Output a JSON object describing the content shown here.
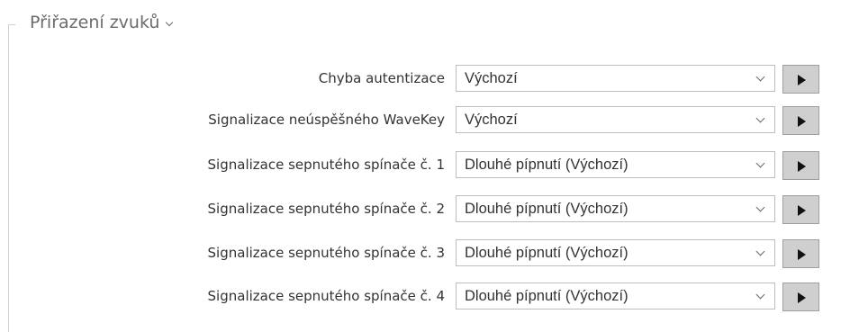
{
  "section": {
    "title": "Přiřazení zvuků"
  },
  "rows": [
    {
      "label": "Chyba autentizace",
      "value": "Výchozí"
    },
    {
      "label": "Signalizace neúspěšného WaveKey",
      "value": "Výchozí"
    },
    {
      "label": "Signalizace sepnutého spínače č. 1",
      "value": "Dlouhé pípnutí (Výchozí)"
    },
    {
      "label": "Signalizace sepnutého spínače č. 2",
      "value": "Dlouhé pípnutí (Výchozí)"
    },
    {
      "label": "Signalizace sepnutého spínače č. 3",
      "value": "Dlouhé pípnutí (Výchozí)"
    },
    {
      "label": "Signalizace sepnutého spínače č. 4",
      "value": "Dlouhé pípnutí (Výchozí)"
    }
  ],
  "icons": {
    "section_toggle": "chevron-down-icon",
    "select_arrow": "chevron-down-icon",
    "play": "play-icon"
  },
  "colors": {
    "play_button_bg": "#cfcfcf",
    "label_text": "#333333",
    "section_title": "#6b6b6b"
  }
}
